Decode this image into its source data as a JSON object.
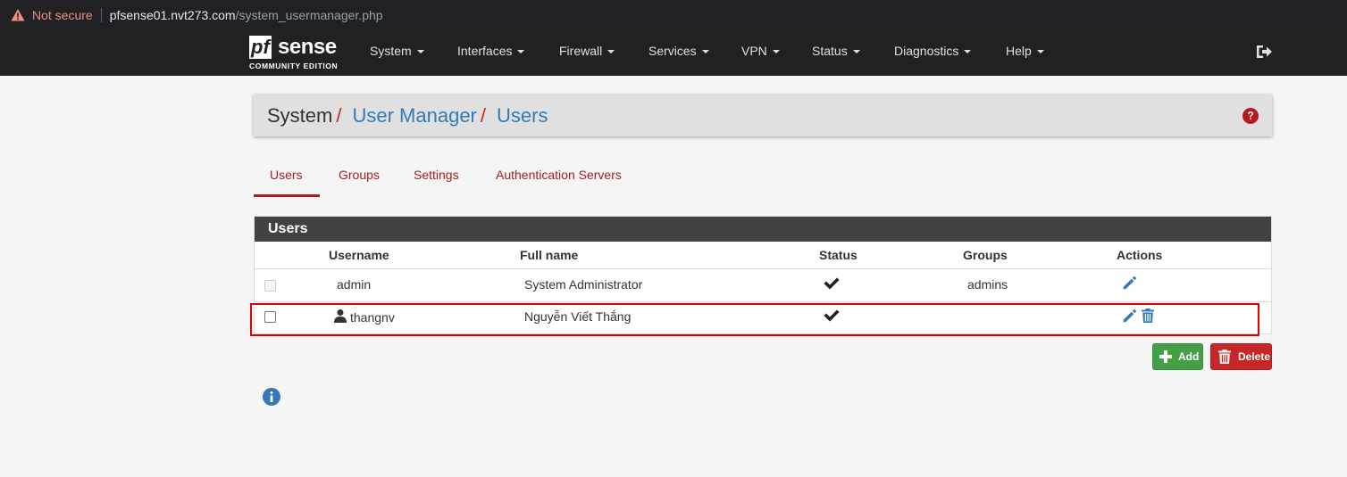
{
  "browser": {
    "not_secure": "Not secure",
    "host": "pfsense01.nvt273.com",
    "path": "/system_usermanager.php"
  },
  "navbar": {
    "logo_pf": "pf",
    "logo_sense": "sense",
    "logo_edition": "COMMUNITY EDITION",
    "items": [
      "System",
      "Interfaces",
      "Firewall",
      "Services",
      "VPN",
      "Status",
      "Diagnostics",
      "Help"
    ]
  },
  "breadcrumb": {
    "system": "System",
    "user_manager": "User Manager",
    "users": "Users"
  },
  "tabs": [
    "Users",
    "Groups",
    "Settings",
    "Authentication Servers"
  ],
  "users_panel": {
    "title": "Users",
    "columns": [
      "Username",
      "Full name",
      "Status",
      "Groups",
      "Actions"
    ],
    "rows": [
      {
        "username": "admin",
        "fullname": "System Administrator",
        "groups": "admins"
      },
      {
        "username": "thangnv",
        "fullname": "Nguyễn Viết Thắng",
        "groups": ""
      }
    ]
  },
  "buttons": {
    "add": "Add",
    "delete": "Delete"
  },
  "colors": {
    "navbar": "#212121",
    "accent_red": "#a41e22",
    "link_blue": "#337ab7",
    "add_green": "#43a047",
    "delete_red": "#c62828"
  }
}
